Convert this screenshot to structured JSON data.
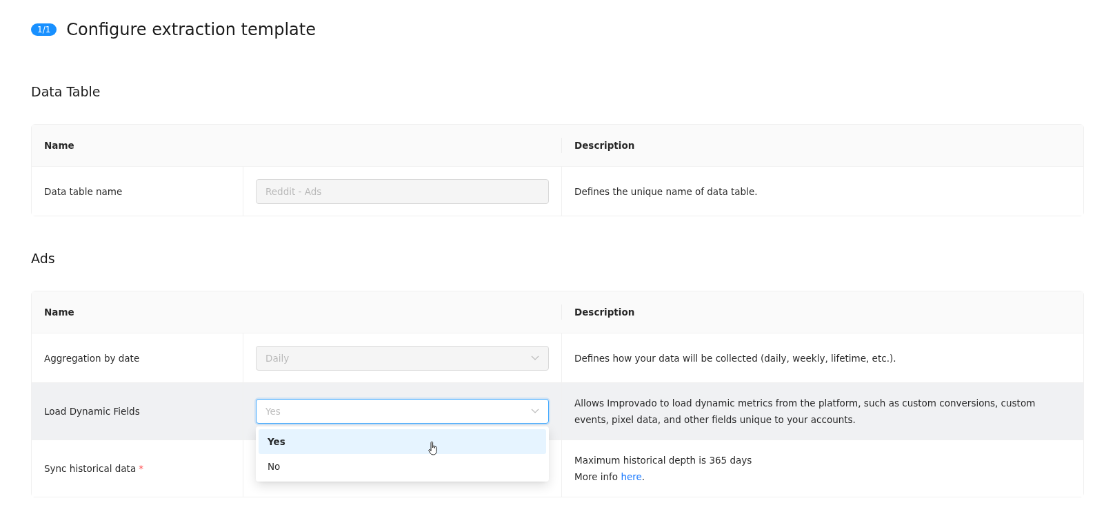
{
  "header": {
    "badge": "1/1",
    "title": "Configure extraction template"
  },
  "sections": [
    {
      "title": "Data Table",
      "columns": [
        "Name",
        "",
        "Description"
      ],
      "rows": [
        {
          "name": "Data table name",
          "highlighted": false,
          "control": {
            "kind": "input",
            "value": "Reddit - Ads",
            "disabled": true,
            "focused": false
          },
          "description": [
            {
              "text": "Defines the unique name of data table."
            }
          ]
        }
      ]
    },
    {
      "title": "Ads",
      "columns": [
        "Name",
        "",
        "Description"
      ],
      "rows": [
        {
          "name": "Aggregation by date",
          "highlighted": false,
          "control": {
            "kind": "select",
            "value": "Daily",
            "disabled": true,
            "focused": false
          },
          "description": [
            {
              "text": "Defines how your data will be collected (daily, weekly, lifetime, etc.)."
            }
          ]
        },
        {
          "name": "Load Dynamic Fields",
          "highlighted": true,
          "control": {
            "kind": "select",
            "placeholder": "Yes",
            "disabled": false,
            "focused": true,
            "options": [
              {
                "label": "Yes",
                "highlighted": true
              },
              {
                "label": "No",
                "highlighted": false
              }
            ]
          },
          "description": [
            {
              "text": "Allows Improvado to load dynamic metrics from the platform, such as custom conversions, custom events, pixel data, and other fields unique to your accounts."
            }
          ]
        },
        {
          "name": "Sync historical data",
          "required_mark": "*",
          "highlighted": false,
          "control": {
            "kind": "none"
          },
          "description": [
            {
              "text": "Maximum historical depth is 365 days"
            },
            {
              "text": "More info ",
              "link": "here",
              "after": "."
            }
          ]
        }
      ]
    }
  ]
}
